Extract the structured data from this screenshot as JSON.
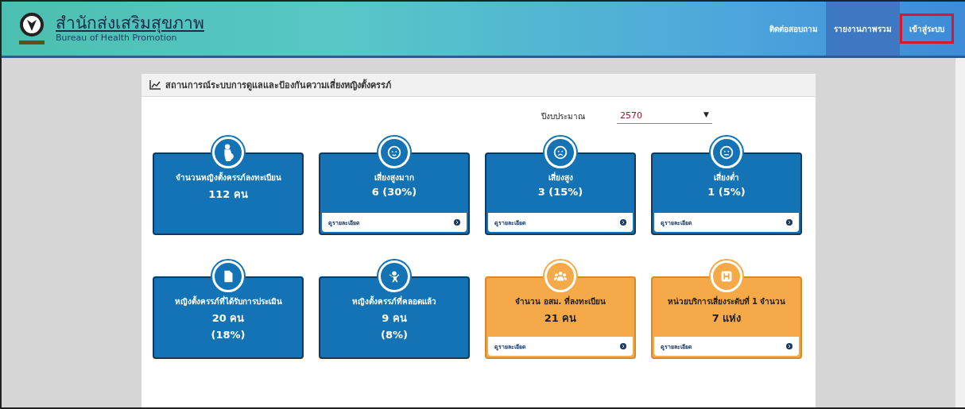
{
  "header": {
    "title": "สำนักส่งเสริมสุขภาพ",
    "subtitle": "Bureau of Health Promotion"
  },
  "nav": [
    {
      "label": "ติดต่อสอบถาม",
      "selected": false,
      "highlighted": false
    },
    {
      "label": "รายงานภาพรวม",
      "selected": true,
      "highlighted": false
    },
    {
      "label": "เข้าสู่ระบบ",
      "selected": false,
      "highlighted": true
    }
  ],
  "panel": {
    "title": "สถานการณ์ระบบการดูแลและป้องกันความเสี่ยงหญิงตั้งครรภ์",
    "filter_label": "ปีงบประมาณ",
    "filter_value": "2570",
    "filter_caret": "▼"
  },
  "cards": [
    {
      "color": "#1473b5",
      "title": "จำนวนหญิงตั้งครรภ์ลงทะเบียน",
      "lines": [
        "112 คน"
      ]
    },
    {
      "color": "#1473b5",
      "title": "เสี่ยงสูงมาก",
      "lines": [
        "6 (30%)"
      ],
      "link": "ดูรายละเอียด"
    },
    {
      "color": "#1473b5",
      "title": "เสี่ยงสูง",
      "lines": [
        "3 (15%)"
      ],
      "link": "ดูรายละเอียด"
    },
    {
      "color": "#1473b5",
      "title": "เสี่ยงต่ำ",
      "lines": [
        "1 (5%)"
      ],
      "link": "ดูรายละเอียด"
    },
    {
      "color": "#1473b5",
      "title": "หญิงตั้งครรภ์ที่ได้รับการประเมิน",
      "lines": [
        "20 คน",
        "(18%)"
      ]
    },
    {
      "color": "#1473b5",
      "title": "หญิงตั้งครรภ์ที่คลอดแล้ว",
      "lines": [
        "9 คน",
        "(8%)"
      ]
    },
    {
      "color": "#f5a948",
      "title": "จำนวน อสม. ที่ลงทะเบียน",
      "lines": [
        "21 คน"
      ],
      "link": "ดูรายละเอียด"
    },
    {
      "color": "#f5a948",
      "title": "หน่วยบริการเสี่ยงระดับที่ 1 จำนวน",
      "lines": [
        "7 แห่ง"
      ],
      "link": "ดูรายละเอียด"
    }
  ]
}
